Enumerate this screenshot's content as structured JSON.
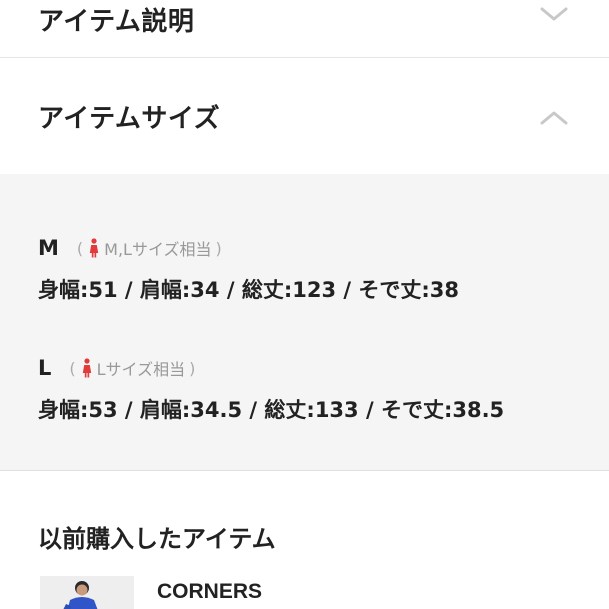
{
  "sections": {
    "description": {
      "title": "アイテム説明",
      "expanded": false
    },
    "size": {
      "title": "アイテムサイズ",
      "expanded": true
    }
  },
  "sizes": [
    {
      "label": "M",
      "note": "M,Lサイズ相当",
      "measurements": "身幅:51 / 肩幅:34 / 総丈:123 / そで丈:38"
    },
    {
      "label": "L",
      "note": "Lサイズ相当",
      "measurements": "身幅:53 / 肩幅:34.5 / 総丈:133 / そで丈:38.5"
    }
  ],
  "previous": {
    "title": "以前購入したアイテム",
    "items": [
      {
        "brand": "CORNERS"
      }
    ]
  },
  "colors": {
    "person_icon": "#e03c3c",
    "panel_bg": "#f5f5f5",
    "chevron": "#c8c8c8"
  },
  "icons": {
    "collapsed": "chevron-down-icon",
    "expanded": "chevron-up-icon",
    "size_note": "female-figure-icon"
  }
}
